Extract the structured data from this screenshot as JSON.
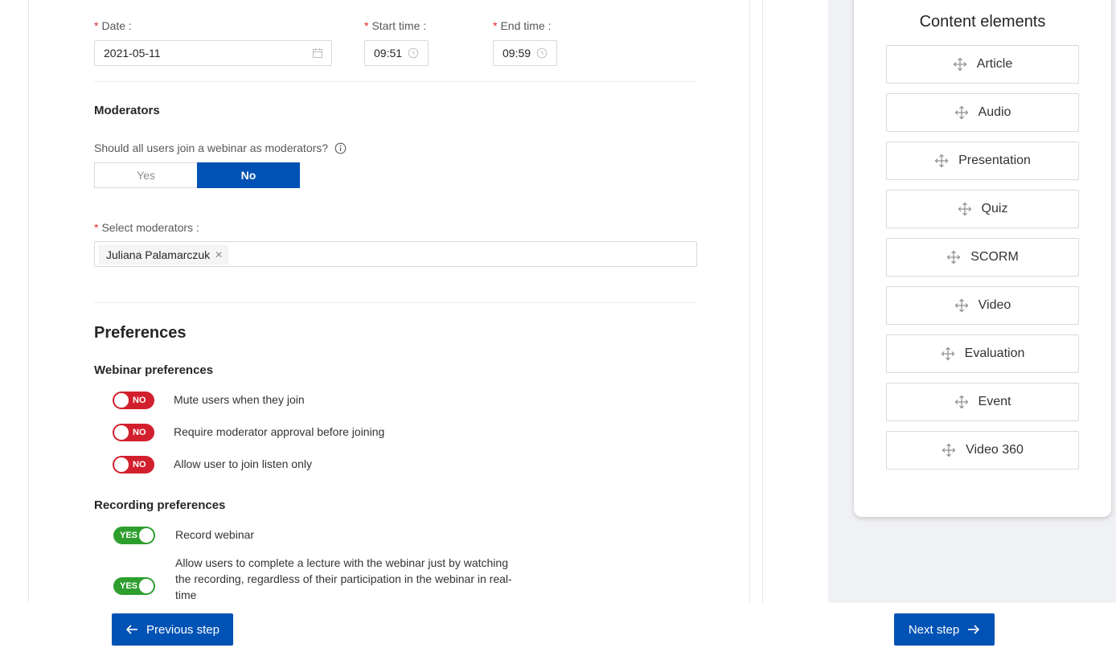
{
  "form": {
    "date": {
      "label": "Date",
      "value": "2021-05-11"
    },
    "start_time": {
      "label": "Start time",
      "value": "09:51"
    },
    "end_time": {
      "label": "End time",
      "value": "09:59"
    },
    "moderators_heading": "Moderators",
    "moderators_question": "Should all users join a webinar as moderators?",
    "segmented": {
      "yes": "Yes",
      "no": "No",
      "selected": "No"
    },
    "select_moderators_label": "Select moderators",
    "selected_moderators": [
      "Juliana Palamarczuk"
    ],
    "preferences_heading": "Preferences",
    "webinar_prefs_heading": "Webinar preferences",
    "webinar_prefs": [
      {
        "label": "Mute users when they join",
        "state": "NO"
      },
      {
        "label": "Require moderator approval before joining",
        "state": "NO"
      },
      {
        "label": "Allow user to join listen only",
        "state": "NO"
      }
    ],
    "recording_prefs_heading": "Recording preferences",
    "recording_prefs": [
      {
        "label": "Record webinar",
        "state": "YES"
      },
      {
        "label": "Allow users to complete a lecture with the webinar just by watching the recording, regardless of their participation in the webinar in real-time",
        "state": "YES"
      }
    ]
  },
  "sidebar": {
    "title": "Content elements",
    "items": [
      "Article",
      "Audio",
      "Presentation",
      "Quiz",
      "SCORM",
      "Video",
      "Evaluation",
      "Event",
      "Video 360"
    ]
  },
  "footer": {
    "prev_label": "Previous step",
    "next_label": "Next step"
  },
  "colors": {
    "primary": "#0052b4",
    "switch_off": "#d21f2d",
    "switch_on": "#2e9e2e",
    "required": "#e0262e"
  }
}
